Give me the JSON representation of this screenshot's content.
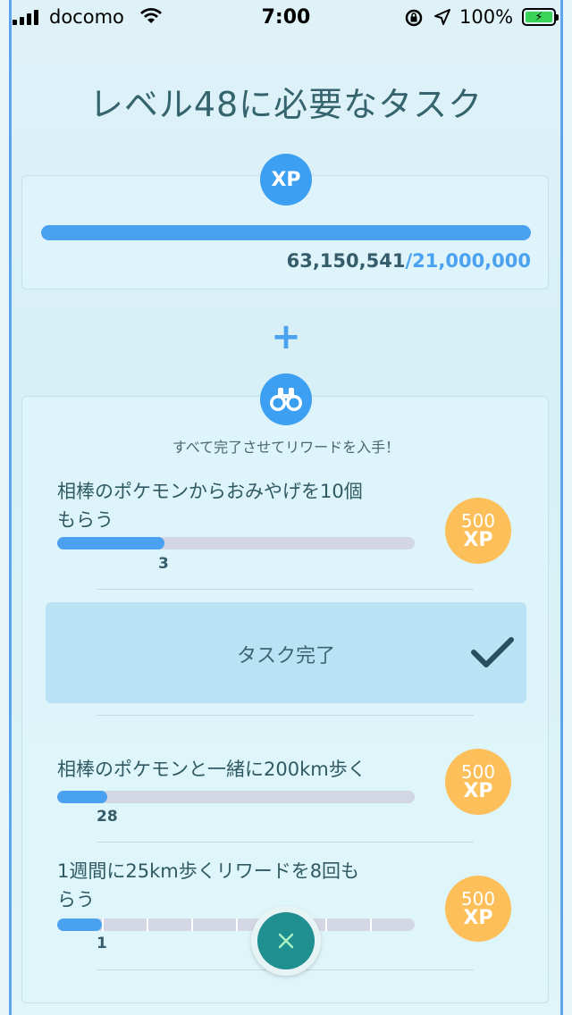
{
  "status_bar": {
    "carrier": "docomo",
    "time": "7:00",
    "battery": "100%"
  },
  "title": "レベル48に必要なタスク",
  "xp_section": {
    "badge": "XP",
    "current": "63,150,541",
    "required": "/21,000,000",
    "progress": 1.0
  },
  "plus_symbol": "+",
  "tasks_section": {
    "complete_all_text": "すべて完了させてリワードを入手！",
    "tasks": [
      {
        "line1": "相棒のポケモンからおみやげを10個",
        "line2": "もらう",
        "progress_value": "3",
        "progress": 0.3,
        "reward_amount": "500",
        "reward_unit": "XP"
      },
      {
        "line1": "相棒のポケモンと一緒に200km歩く",
        "line2": "",
        "progress_value": "28",
        "progress": 0.14,
        "reward_amount": "500",
        "reward_unit": "XP"
      },
      {
        "line1": "1週間に25km歩くリワードを8回も",
        "line2": "らう",
        "progress_value": "1",
        "progress": 0.125,
        "reward_amount": "500",
        "reward_unit": "XP"
      }
    ],
    "completed_task_label": "タスク完了"
  },
  "colors": {
    "accent": "#4aa1f0",
    "reward": "#fdbf5a",
    "close_button": "#1f8f8f"
  },
  "icons": {
    "xp": "xp-badge-icon",
    "binoculars": "binoculars-icon",
    "check": "check-icon",
    "close": "close-icon"
  }
}
